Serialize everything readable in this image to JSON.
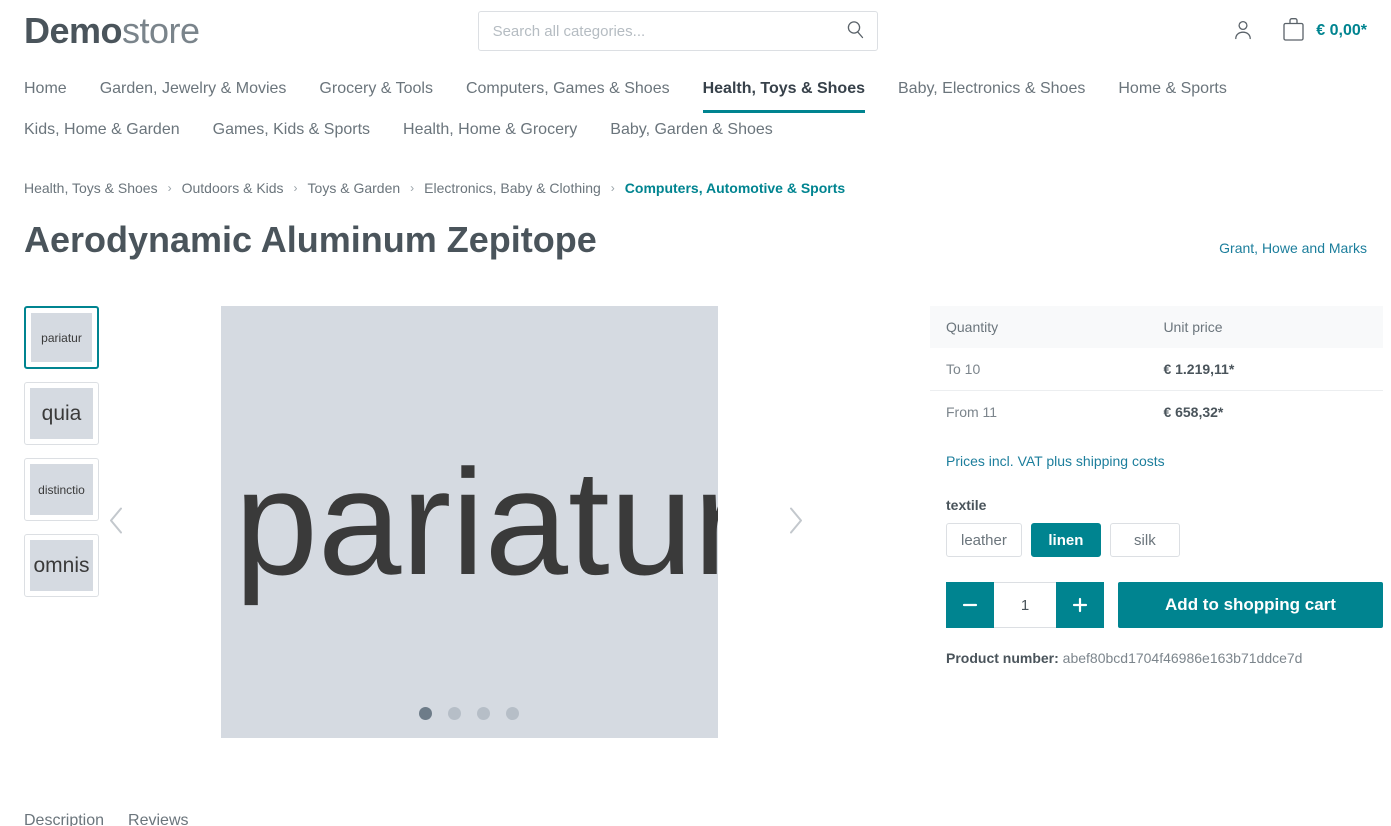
{
  "header": {
    "logo_bold": "Demo",
    "logo_light": "store",
    "search_placeholder": "Search all categories...",
    "search_value": "",
    "search_icon": "search-icon",
    "account_icon": "person-icon",
    "cart_icon": "shopping-bag-icon",
    "cart_amount": "€ 0,00*"
  },
  "nav": {
    "items": [
      {
        "label": "Home",
        "active": false
      },
      {
        "label": "Garden, Jewelry & Movies",
        "active": false
      },
      {
        "label": "Grocery & Tools",
        "active": false
      },
      {
        "label": "Computers, Games & Shoes",
        "active": false
      },
      {
        "label": "Health, Toys & Shoes",
        "active": true
      },
      {
        "label": "Baby, Electronics & Shoes",
        "active": false
      },
      {
        "label": "Home & Sports",
        "active": false
      },
      {
        "label": "Kids, Home & Garden",
        "active": false
      },
      {
        "label": "Games, Kids & Sports",
        "active": false
      },
      {
        "label": "Health, Home & Grocery",
        "active": false
      },
      {
        "label": "Baby, Garden & Shoes",
        "active": false
      }
    ]
  },
  "breadcrumb": {
    "separator": "›",
    "items": [
      "Health, Toys & Shoes",
      "Outdoors & Kids",
      "Toys & Garden",
      "Electronics, Baby & Clothing",
      "Computers, Automotive & Sports"
    ]
  },
  "product": {
    "title": "Aerodynamic Aluminum Zepitope",
    "manufacturer": "Grant, Howe and Marks",
    "product_number_label": "Product number:",
    "product_number": "abef80bcd1704f46986e163b71ddce7d"
  },
  "gallery": {
    "prev_icon": "chevron-left-icon",
    "next_icon": "chevron-right-icon",
    "main_image_text": "pariatur",
    "active_index": 0,
    "dots": 4,
    "thumbnails": [
      {
        "text": "pariatur",
        "size": "small",
        "active": true
      },
      {
        "text": "quia",
        "size": "big",
        "active": false
      },
      {
        "text": "distinctio",
        "size": "tiny",
        "active": false
      },
      {
        "text": "omnis",
        "size": "big",
        "active": false
      }
    ]
  },
  "pricing": {
    "columns": [
      "Quantity",
      "Unit price"
    ],
    "rows": [
      {
        "quantity": "To 10",
        "price": "€ 1.219,11*"
      },
      {
        "quantity": "From 11",
        "price": "€ 658,32*"
      }
    ],
    "vat_note": "Prices incl. VAT plus shipping costs"
  },
  "variants": {
    "label": "textile",
    "options": [
      {
        "label": "leather",
        "selected": false
      },
      {
        "label": "linen",
        "selected": true
      },
      {
        "label": "silk",
        "selected": false
      }
    ]
  },
  "buy": {
    "decrease_icon": "minus-icon",
    "increase_icon": "plus-icon",
    "quantity_value": "1",
    "add_to_cart_label": "Add to shopping cart"
  },
  "bottom_tabs": [
    {
      "label": "Description"
    },
    {
      "label": "Reviews"
    }
  ],
  "colors": {
    "accent": "#008490",
    "link": "#1c7e9c",
    "text": "#4a545b",
    "muted": "#6b757c",
    "placeholder_bg": "#d5dae1",
    "border": "#dcdfe3"
  }
}
